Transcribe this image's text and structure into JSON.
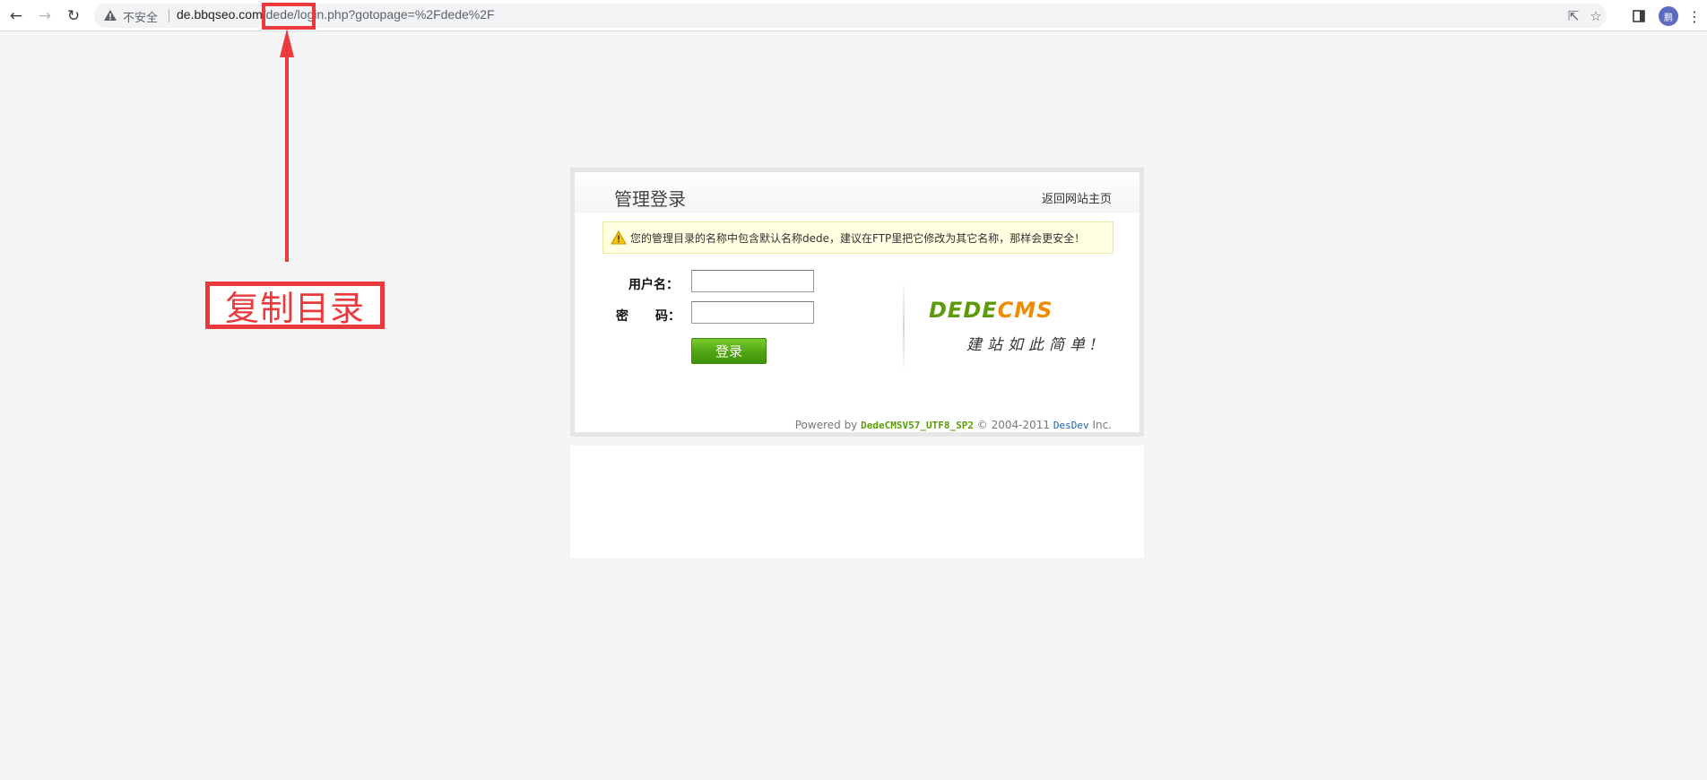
{
  "browser": {
    "insecure_label": "不安全",
    "url_host": "de.bbqseo.com",
    "url_path": "/dede/",
    "url_rest": "login.php?gotopage=%2Fdede%2F",
    "avatar_text": "鹏"
  },
  "annotation": {
    "label": "复制目录",
    "color": "#ea3a3d"
  },
  "login": {
    "title": "管理登录",
    "home_link": "返回网站主页",
    "notice": "您的管理目录的名称中包含默认名称dede，建议在FTP里把它修改为其它名称，那样会更安全！",
    "username_label": "用户名：",
    "password_label_1": "密",
    "password_label_2": "码：",
    "username_value": "",
    "password_value": "",
    "submit_label": "登录",
    "brand_part1": "DEDE",
    "brand_part2": "CMS",
    "slogan": "建站如此简单!",
    "footer_prefix": "Powered by",
    "footer_version": "DedeCMSV57_UTF8_SP2",
    "footer_copy": "© 2004-2011",
    "footer_org": "DesDev",
    "footer_suffix": "Inc."
  },
  "colors": {
    "accent_green": "#5e9b0b",
    "accent_orange": "#f08a00",
    "notice_bg": "#ffffe1"
  }
}
